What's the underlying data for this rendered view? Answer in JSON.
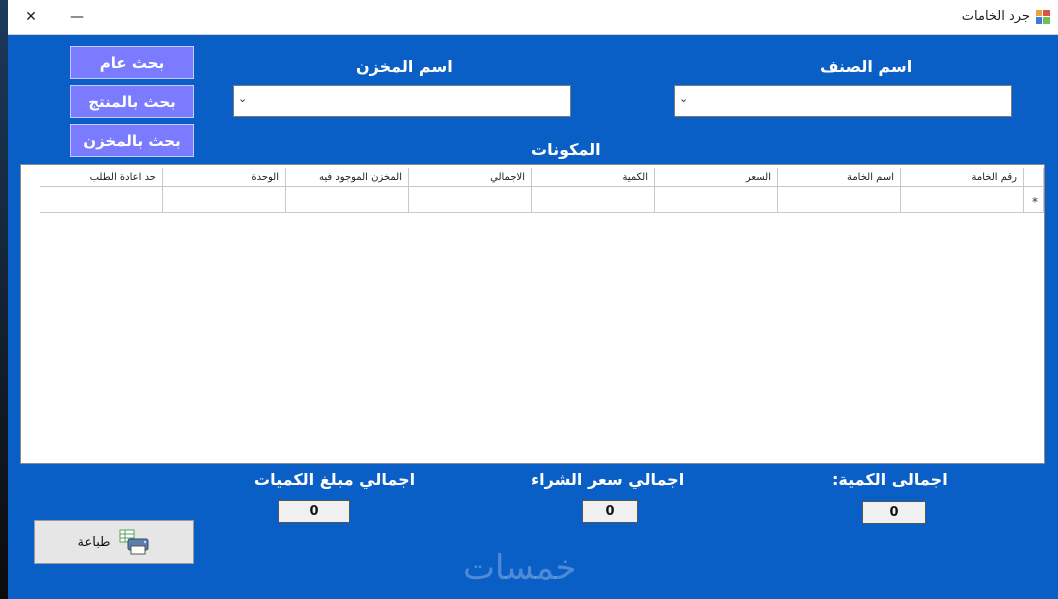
{
  "window": {
    "title": "جرد الخامات",
    "close_glyph": "✕",
    "minimize_glyph": "—"
  },
  "filters": {
    "category_label": "اسم الصنف",
    "warehouse_label": "اسم المخزن",
    "category_value": "",
    "warehouse_value": ""
  },
  "buttons": {
    "search_general": "بحث عام",
    "search_by_product": "بحث بالمنتج",
    "search_by_warehouse": "بحث بالمخزن",
    "print": "طباعة"
  },
  "grid": {
    "title": "المكونات",
    "columns": [
      "رقم الخامة",
      "اسم الخامة",
      "السعر",
      "الكمية",
      "الاجمالي",
      "المخزن الموجود فيه",
      "الوحدة",
      "حد اعادة الطلب"
    ],
    "new_row_marker": "*"
  },
  "totals": {
    "quantity_label": "اجمالى الكمية:",
    "quantity_value": "0",
    "purchase_label": "اجمالي سعر الشراء",
    "purchase_value": "0",
    "amount_label": "اجمالي مبلغ الكميات",
    "amount_value": "0"
  },
  "watermark": "خمسات"
}
